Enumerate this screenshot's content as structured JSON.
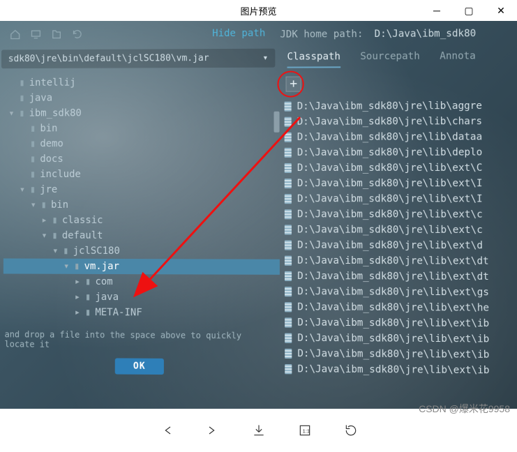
{
  "window": {
    "title": "图片预览"
  },
  "ide": {
    "hide_path": "Hide path",
    "path": "sdk80\\jre\\bin\\default\\jclSC180\\vm.jar",
    "tree": [
      {
        "d": 0,
        "c": "",
        "t": "intellij",
        "f": true
      },
      {
        "d": 0,
        "c": "",
        "t": "java",
        "f": true
      },
      {
        "d": 0,
        "c": "v",
        "t": "ibm_sdk80",
        "f": true
      },
      {
        "d": 1,
        "c": "",
        "t": "bin",
        "f": true
      },
      {
        "d": 1,
        "c": "",
        "t": "demo",
        "f": true
      },
      {
        "d": 1,
        "c": "",
        "t": "docs",
        "f": true
      },
      {
        "d": 1,
        "c": "",
        "t": "include",
        "f": true
      },
      {
        "d": 1,
        "c": "v",
        "t": "jre",
        "f": true
      },
      {
        "d": 2,
        "c": "v",
        "t": "bin",
        "f": true
      },
      {
        "d": 3,
        "c": ">",
        "t": "classic",
        "f": true
      },
      {
        "d": 3,
        "c": "v",
        "t": "default",
        "f": true
      },
      {
        "d": 4,
        "c": "v",
        "t": "jclSC180",
        "f": true
      },
      {
        "d": 5,
        "c": "v",
        "t": "vm.jar",
        "f": false,
        "sel": true
      },
      {
        "d": 6,
        "c": ">",
        "t": "com",
        "f": true
      },
      {
        "d": 6,
        "c": ">",
        "t": "java",
        "f": true
      },
      {
        "d": 6,
        "c": ">",
        "t": "META-INF",
        "f": true
      }
    ],
    "hint": "and drop a file into the space above to quickly locate it",
    "ok": "OK",
    "jdk_label": "JDK home path:",
    "jdk_value": "D:\\Java\\ibm_sdk80",
    "tabs": {
      "classpath": "Classpath",
      "sourcepath": "Sourcepath",
      "annota": "Annota"
    },
    "classpath": [
      "D:\\Java\\ibm_sdk80\\jre\\lib\\aggre",
      "D:\\Java\\ibm_sdk80\\jre\\lib\\chars",
      "D:\\Java\\ibm_sdk80\\jre\\lib\\dataa",
      "D:\\Java\\ibm_sdk80\\jre\\lib\\deplo",
      "D:\\Java\\ibm_sdk80\\jre\\lib\\ext\\C",
      "D:\\Java\\ibm_sdk80\\jre\\lib\\ext\\I",
      "D:\\Java\\ibm_sdk80\\jre\\lib\\ext\\I",
      "D:\\Java\\ibm_sdk80\\jre\\lib\\ext\\c",
      "D:\\Java\\ibm_sdk80\\jre\\lib\\ext\\c",
      "D:\\Java\\ibm_sdk80\\jre\\lib\\ext\\d",
      "D:\\Java\\ibm_sdk80\\jre\\lib\\ext\\dt",
      "D:\\Java\\ibm_sdk80\\jre\\lib\\ext\\dt",
      "D:\\Java\\ibm_sdk80\\jre\\lib\\ext\\gs",
      "D:\\Java\\ibm_sdk80\\jre\\lib\\ext\\he",
      "D:\\Java\\ibm_sdk80\\jre\\lib\\ext\\ib",
      "D:\\Java\\ibm_sdk80\\jre\\lib\\ext\\ib",
      "D:\\Java\\ibm_sdk80\\jre\\lib\\ext\\ib",
      "D:\\Java\\ibm_sdk80\\jre\\lib\\ext\\ib"
    ]
  },
  "watermark": "CSDN @爆米花9958"
}
